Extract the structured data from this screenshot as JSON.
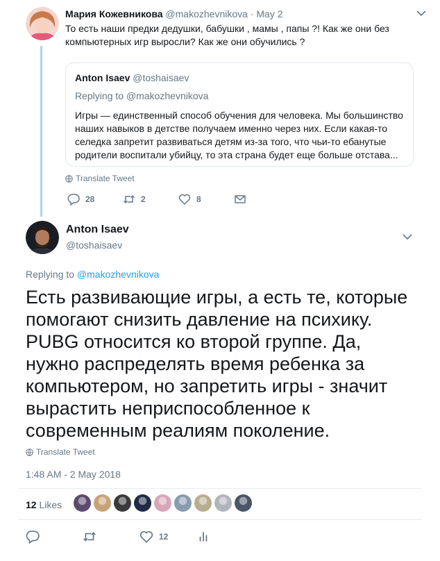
{
  "parent_tweet": {
    "author_name": "Мария Кожевникова",
    "handle": "@makozhevnikova",
    "separator": "·",
    "date": "May 2",
    "text": "То есть наши предки дедушки, бабушки , мамы , папы ?! Как же они без компьютерных игр выросли? Как же они обучились ?",
    "quoted": {
      "author_name": "Anton Isaev",
      "handle": "@toshaisaev",
      "replying_prefix": "Replying to",
      "replying_handle": "@makozhevnikova",
      "text": "Игры — единственный способ обучения для человека. Мы большинство наших навыков в детстве получаем именно через них. Если какая-то селедка запретит развиваться детям из-за того, что чьи-то ебанутые родители воспитали убийцу, то эта страна будет еще больше отстава..."
    },
    "translate_label": "Translate Tweet",
    "actions": {
      "reply_count": "28",
      "retweet_count": "2",
      "like_count": "8",
      "message_icon": "envelope-icon"
    }
  },
  "main_tweet": {
    "author_name": "Anton Isaev",
    "handle": "@toshaisaev",
    "replying_prefix": "Replying to",
    "replying_handle": "@makozhevnikova",
    "text": "Есть развивающие игры, а есть те, которые помогают снизить давление на психику. PUBG относится ко второй группе. Да, нужно распределять время ребенка за компьютером, но запретить игры - значит вырастить неприспособленное к современным реалиям поколение.",
    "translate_label": "Translate Tweet",
    "timestamp": "1:48 AM - 2 May 2018",
    "likes_count": "12",
    "likes_label": "Likes",
    "likers": [
      {
        "color": "#5b4a6e"
      },
      {
        "color": "#c9a27a"
      },
      {
        "color": "#3a3a3a"
      },
      {
        "color": "#1f2a44"
      },
      {
        "color": "#d8a6b8"
      },
      {
        "color": "#8a9bb0"
      },
      {
        "color": "#b8ad8f"
      },
      {
        "color": "#b0b4bb"
      },
      {
        "color": "#4a5566"
      }
    ],
    "actions": {
      "reply_count": "",
      "retweet_count": "",
      "like_count": "12",
      "analytics_icon": "bar-chart-icon"
    }
  },
  "colors": {
    "link_blue": "#1da1f2",
    "muted_gray": "#657786",
    "thread_line": "#a8d4f2",
    "divider": "#e6ecf0"
  }
}
